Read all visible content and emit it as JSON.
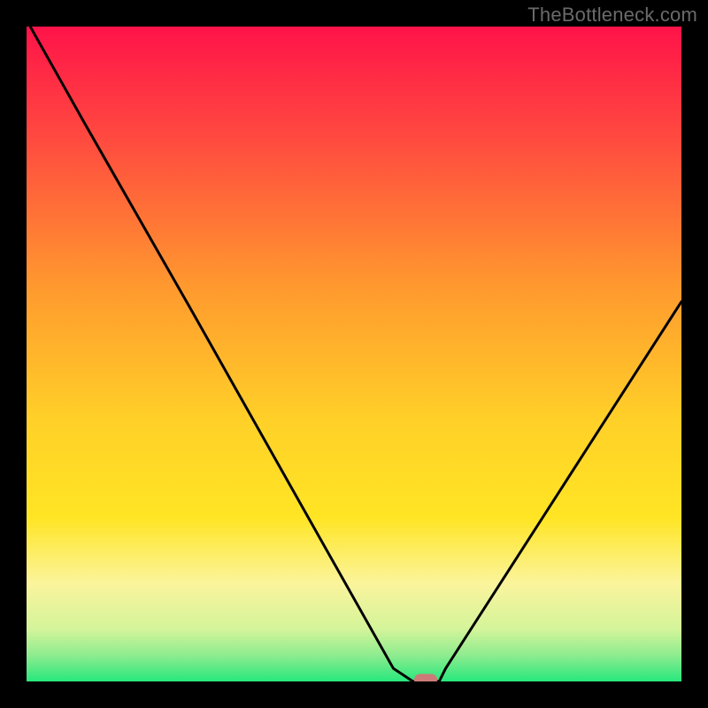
{
  "watermark": "TheBottleneck.com",
  "colors": {
    "bg_black": "#000000",
    "grad_top": "#ff1349",
    "grad_orange": "#ff9a2e",
    "grad_yellow": "#ffe425",
    "grad_pale": "#fbf8a8",
    "grad_green": "#27e77c",
    "curve": "#000000",
    "marker": "#cd7b79"
  },
  "chart_data": {
    "type": "line",
    "title": "",
    "xlabel": "",
    "ylabel": "",
    "xlim": [
      0,
      100
    ],
    "ylim": [
      0,
      100
    ],
    "grid": false,
    "legend": false,
    "annotations": [],
    "series": [
      {
        "name": "curve",
        "x": [
          0,
          9,
          25,
          56,
          59,
          63,
          64,
          100
        ],
        "values": [
          101,
          85,
          57,
          2,
          0,
          0,
          2,
          58
        ]
      }
    ],
    "marker": {
      "x": 61,
      "y": 0.3
    },
    "gradient_stops": [
      {
        "pct": 0,
        "color": "#ff1349"
      },
      {
        "pct": 18,
        "color": "#ff4d3f"
      },
      {
        "pct": 40,
        "color": "#ff9a2e"
      },
      {
        "pct": 60,
        "color": "#ffd028"
      },
      {
        "pct": 75,
        "color": "#ffe524"
      },
      {
        "pct": 85,
        "color": "#fbf49c"
      },
      {
        "pct": 92,
        "color": "#d4f49a"
      },
      {
        "pct": 96,
        "color": "#8eec8f"
      },
      {
        "pct": 100,
        "color": "#27e77c"
      }
    ]
  }
}
